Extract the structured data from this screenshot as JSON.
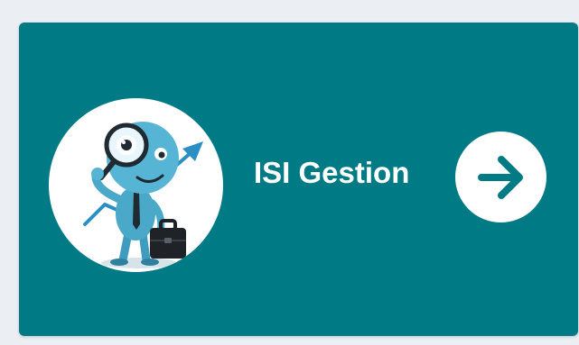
{
  "card": {
    "title": "ISI Gestion",
    "illustration_icon": "mascot-with-magnifier-and-briefcase-icon",
    "action_icon": "arrow-right-circle-icon"
  },
  "colors": {
    "background": "#ebeff3",
    "card": "#007b85",
    "text": "#ffffff",
    "arrow": "#007b85",
    "mascot": "#4aa8c8"
  }
}
